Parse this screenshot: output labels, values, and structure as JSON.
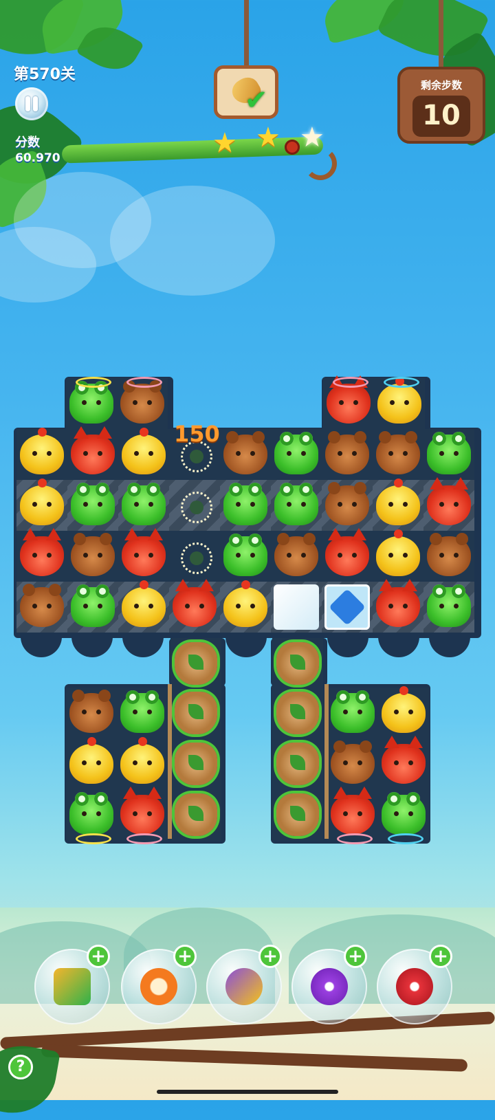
{
  "hud": {
    "level": "第570关",
    "score_label": "分数",
    "score_value": "60.970",
    "moves_label": "剩余步数",
    "moves_value": "10",
    "stars_earned": 2,
    "stars_total": 3
  },
  "goal": {
    "icon": "pastry-goal-icon",
    "status": "complete"
  },
  "combo_popup": "150",
  "colors": {
    "chick": "#f4c21a",
    "frog": "#3cbf2a",
    "bear": "#9a4f1e",
    "fox": "#e0321d",
    "board": "#1d3450"
  },
  "board": {
    "top_rows": [
      [
        "chick",
        "fox",
        "chick",
        "cleared",
        "bear",
        "frog",
        "bear",
        "bear",
        "frog"
      ],
      [
        "chick",
        "frog",
        "frog",
        "cleared",
        "frog",
        "frog",
        "bear",
        "chick",
        "fox"
      ],
      [
        "fox",
        "bear",
        "fox",
        "cleared",
        "frog",
        "bear",
        "fox",
        "chick",
        "bear"
      ],
      [
        "bear",
        "frog",
        "chick",
        "fox",
        "chick",
        "ice",
        "crystal",
        "fox",
        "frog"
      ]
    ],
    "left_tower": [
      "frog",
      "bear"
    ],
    "right_tower": [
      "fox",
      "chick"
    ],
    "left_bottom": [
      [
        "bear",
        "frog"
      ],
      [
        "chick",
        "chick"
      ],
      [
        "frog",
        "fox"
      ]
    ],
    "right_bottom": [
      [
        "frog",
        "chick"
      ],
      [
        "bear",
        "fox"
      ],
      [
        "fox",
        "frog"
      ]
    ]
  },
  "boosters": [
    {
      "name": "shuffle-booster",
      "icon": "shuffle-icon"
    },
    {
      "name": "extra-time-booster",
      "icon": "clock-icon"
    },
    {
      "name": "swap-booster",
      "icon": "swap-icon"
    },
    {
      "name": "row-rocket-booster",
      "icon": "horizontal-rocket-icon"
    },
    {
      "name": "column-rocket-booster",
      "icon": "vertical-rocket-icon"
    }
  ],
  "help_label": "?"
}
